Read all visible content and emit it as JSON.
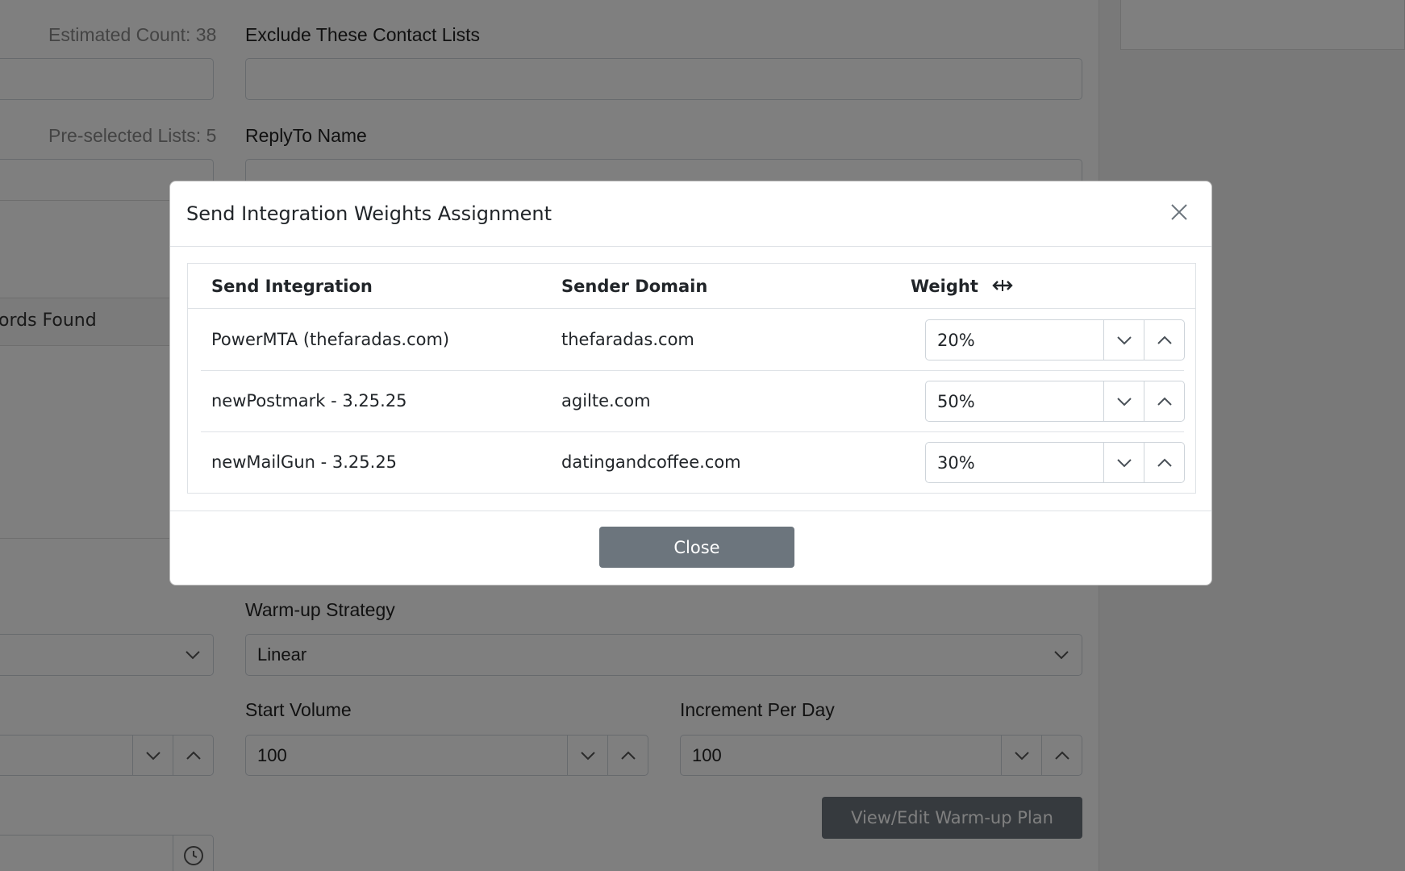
{
  "background": {
    "estimated_count_label": "Estimated Count: 38",
    "exclude_lists_label": "Exclude These Contact Lists",
    "preselected_label": "Pre-selected Lists: 5",
    "replyto_label": "ReplyTo Name",
    "records_found_text": "ords Found",
    "warmup_strategy_label": "Warm-up Strategy",
    "warmup_strategy_value": "Linear",
    "start_volume_label": "Start Volume",
    "start_volume_value": "100",
    "increment_label": "Increment Per Day",
    "increment_value": "100",
    "warmup_plan_button": "View/Edit Warm-up Plan"
  },
  "modal": {
    "title": "Send Integration Weights Assignment",
    "columns": {
      "integration": "Send Integration",
      "domain": "Sender Domain",
      "weight": "Weight"
    },
    "rows": [
      {
        "integration": "PowerMTA (thefaradas.com)",
        "domain": "thefaradas.com",
        "weight": "20%"
      },
      {
        "integration": "newPostmark - 3.25.25",
        "domain": "agilte.com",
        "weight": "50%"
      },
      {
        "integration": "newMailGun - 3.25.25",
        "domain": "datingandcoffee.com",
        "weight": "30%"
      }
    ],
    "close_label": "Close"
  },
  "colors": {
    "backdrop": "#000000",
    "secondary_button": "#6c757d",
    "border": "#dee2e6"
  }
}
